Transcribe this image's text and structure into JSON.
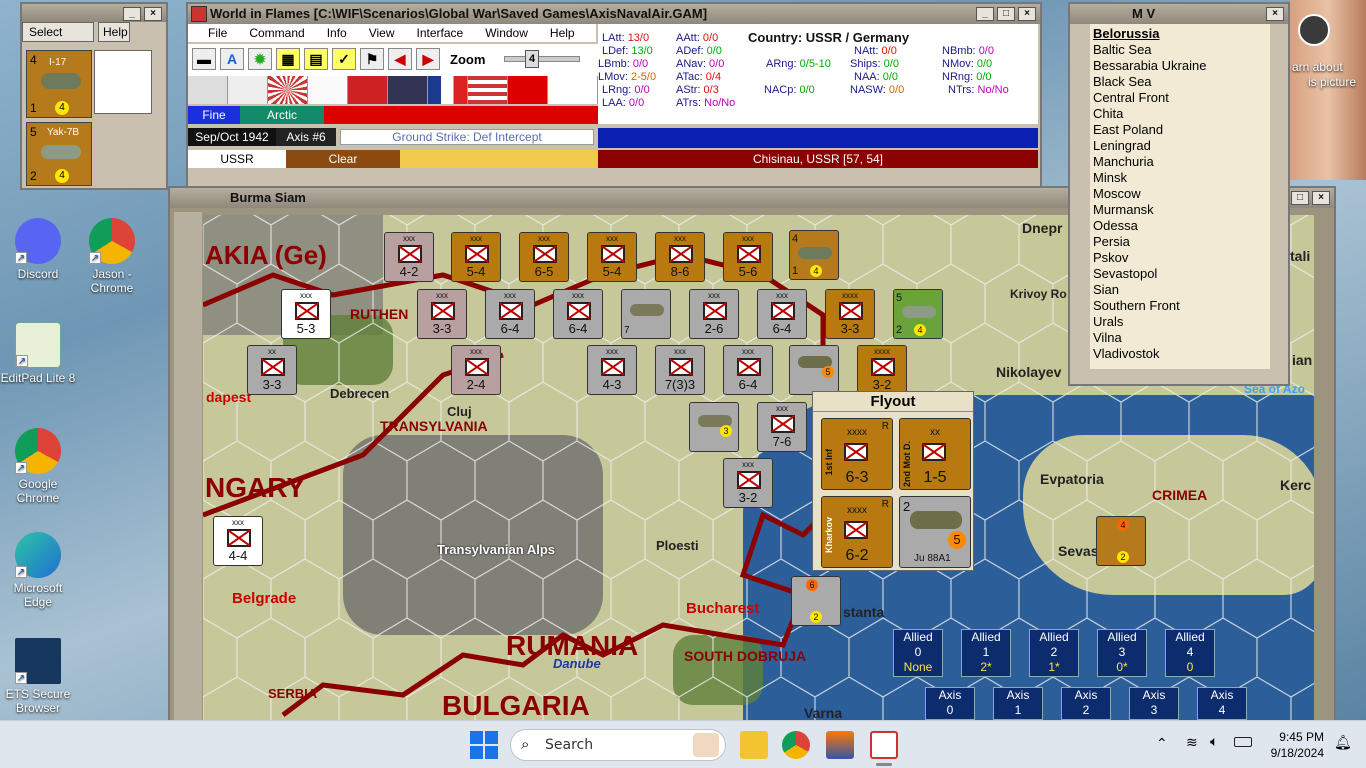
{
  "desktop_icons": [
    {
      "label": "Discord",
      "icon": "discord-icon"
    },
    {
      "label": "Jason -\nChrome",
      "icon": "chrome-profile-icon"
    },
    {
      "label": "EditPad Lite 8",
      "icon": "editpad-icon"
    },
    {
      "label": "Google\nChrome",
      "icon": "chrome-icon"
    },
    {
      "label": "Microsoft\nEdge",
      "icon": "edge-icon"
    },
    {
      "label": "ETS Secure\nBrowser",
      "icon": "ets-icon"
    }
  ],
  "desktop_peek": {
    "learn": "arn about",
    "picture": "is picture"
  },
  "select_window": {
    "tab_select": "Select",
    "tab_help": "Help",
    "units": [
      {
        "name": "I-17",
        "top": "4",
        "bottom": "1",
        "circle": "4"
      },
      {
        "name": "Yak-7B",
        "top": "5",
        "bottom": "2",
        "circle": "4"
      }
    ]
  },
  "main_window": {
    "title": "World in Flames [C:\\WIF\\Scenarios\\Global War\\Saved Games\\AxisNavalAir.GAM]",
    "menu": [
      "File",
      "Command",
      "Info",
      "View",
      "Interface",
      "Window",
      "Help"
    ],
    "zoom_label": "Zoom",
    "zoom_value": "4",
    "weather": "Fine",
    "zone": "Arctic",
    "date": "Sep/Oct 1942",
    "impulse": "Axis #6",
    "phase": "Ground Strike: Def Intercept",
    "hex_owner": "USSR",
    "terrain": "Clear",
    "location": "Chisinau, USSR [57, 54]",
    "country": "Country: USSR / Germany",
    "stats": [
      [
        "LAtt:",
        "13/0",
        "AAtt:",
        "0/0",
        "",
        "",
        "NAtt:",
        "0/0",
        "NBmb:",
        "0/0"
      ],
      [
        "LDef:",
        "13/0",
        "ADef:",
        "0/0",
        "",
        "",
        "Ships:",
        "0/0",
        "NMov:",
        "0/0"
      ],
      [
        "LBmb:",
        "0/0",
        "ANav:",
        "0/0",
        "ARng:",
        "0/5-10",
        "Ships:",
        "0/0",
        "NMov:",
        "0/0"
      ],
      [
        "LMov:",
        "2-5/0",
        "ATac:",
        "0/4",
        "",
        "",
        "NAA:",
        "0/0",
        "NRng:",
        "0/0"
      ],
      [
        "LRng:",
        "0/0",
        "AStr:",
        "0/3",
        "NACp:",
        "0/0",
        "NASW:",
        "0/0",
        "NTrs:",
        "No/No"
      ],
      [
        "LAA:",
        "0/0",
        "ATrs:",
        "No/No",
        "",
        "",
        "",
        "",
        "",
        ""
      ]
    ]
  },
  "map_window": {
    "title": "Burma Siam",
    "labels": [
      {
        "text": "AKIA (Ge)",
        "color": "#8b0000"
      },
      {
        "text": "RUTHEN",
        "color": "#8b0000"
      },
      {
        "text": "Debrecen",
        "color": "#222"
      },
      {
        "text": "Cluj",
        "color": "#222"
      },
      {
        "text": "TRANSYLVANIA",
        "color": "#8b0000"
      },
      {
        "text": "NGARY",
        "color": "#8b0000"
      },
      {
        "text": "Transylvanian Alps",
        "color": "#fff"
      },
      {
        "text": "Ploesti",
        "color": "#222"
      },
      {
        "text": "Bucharest",
        "color": "#c00"
      },
      {
        "text": "Belgrade",
        "color": "#c00"
      },
      {
        "text": "RUMANIA",
        "color": "#8b0000"
      },
      {
        "text": "Danube",
        "color": "#1a3aa0"
      },
      {
        "text": "SOUTH DOBRUJA",
        "color": "#8b0000"
      },
      {
        "text": "SERBIA",
        "color": "#8b0000"
      },
      {
        "text": "BULGARIA",
        "color": "#8b0000"
      },
      {
        "text": "Varna",
        "color": "#222"
      },
      {
        "text": "stanta",
        "color": "#222"
      },
      {
        "text": "dapest",
        "color": "#c00"
      },
      {
        "text": "Dnepr",
        "color": "#222"
      },
      {
        "text": "Krivoy Ro",
        "color": "#222"
      },
      {
        "text": "Nikolayev",
        "color": "#222"
      },
      {
        "text": "Evpatoria",
        "color": "#222"
      },
      {
        "text": "CRIMEA",
        "color": "#8b0000"
      },
      {
        "text": "Sevas",
        "color": "#222"
      },
      {
        "text": "Kerc",
        "color": "#222"
      },
      {
        "text": "Sea of Azo",
        "color": "#3aa0ff"
      },
      {
        "text": "ian",
        "color": "#222"
      },
      {
        "text": "tali",
        "color": "#222"
      }
    ],
    "counters": [
      {
        "v": "4-2",
        "c": "#b9a0a0",
        "s": "xxx"
      },
      {
        "v": "5-4",
        "c": "#b87a10",
        "s": "xxx"
      },
      {
        "v": "6-5",
        "c": "#b87a10",
        "s": "xxx"
      },
      {
        "v": "5-4",
        "c": "#b87a10",
        "s": "xxx"
      },
      {
        "v": "8-6",
        "c": "#b87a10",
        "s": "xxx"
      },
      {
        "v": "5-6",
        "c": "#b87a10",
        "s": "xxx"
      },
      {
        "v": "5-3",
        "c": "#fff",
        "s": "xxx"
      },
      {
        "v": "3-3",
        "c": "#b9a0a0",
        "s": "xxx"
      },
      {
        "v": "6-4",
        "c": "#aaa",
        "s": "xxx"
      },
      {
        "v": "6-4",
        "c": "#aaa",
        "s": "xxx"
      },
      {
        "v": "2-6",
        "c": "#aaa",
        "s": "xxx"
      },
      {
        "v": "6-4",
        "c": "#aaa",
        "s": "xxx"
      },
      {
        "v": "3-3",
        "c": "#b87a10",
        "s": "xxxx"
      },
      {
        "v": "3-3",
        "c": "#aaa",
        "s": "xx"
      },
      {
        "v": "2-4",
        "c": "#b9a0a0",
        "s": "xxx"
      },
      {
        "v": "4-3",
        "c": "#aaa",
        "s": "xxx"
      },
      {
        "v": "7(3)3",
        "c": "#aaa",
        "s": "xxx"
      },
      {
        "v": "6-4",
        "c": "#aaa",
        "s": "xxx"
      },
      {
        "v": "3-2",
        "c": "#b87a10",
        "s": "xxxx"
      },
      {
        "v": "7-6",
        "c": "#aaa",
        "s": "xxx"
      },
      {
        "v": "3-2",
        "c": "#aaa",
        "s": "xxx"
      },
      {
        "v": "4-4",
        "c": "#fff",
        "s": "xxx"
      }
    ],
    "flyout": {
      "title": "Flyout",
      "units": [
        {
          "name": "1st Inf",
          "v": "6-3",
          "s": "xxxx",
          "tag": "R"
        },
        {
          "name": "2nd Mot D.",
          "v": "1-5",
          "s": "xx",
          "tag": ""
        },
        {
          "name": "Kharkov",
          "v": "6-2",
          "s": "xxxx",
          "tag": "R"
        },
        {
          "name": "Ju 88A1",
          "v": "5",
          "s": "",
          "tag": "2"
        }
      ]
    },
    "allied_boxes": [
      {
        "t": "Allied",
        "n": "0",
        "s": "None"
      },
      {
        "t": "Allied",
        "n": "1",
        "s": "2*"
      },
      {
        "t": "Allied",
        "n": "2",
        "s": "1*"
      },
      {
        "t": "Allied",
        "n": "3",
        "s": "0*"
      },
      {
        "t": "Allied",
        "n": "4",
        "s": "0"
      }
    ],
    "axis_boxes": [
      {
        "t": "Axis",
        "n": "0"
      },
      {
        "t": "Axis",
        "n": "1"
      },
      {
        "t": "Axis",
        "n": "2"
      },
      {
        "t": "Axis",
        "n": "3"
      },
      {
        "t": "Axis",
        "n": "4"
      }
    ]
  },
  "mv_window": {
    "title": "M V",
    "items": [
      "Belorussia",
      "Baltic Sea",
      "Bessarabia Ukraine",
      "Black Sea",
      "Central Front",
      "Chita",
      "East Poland",
      "Leningrad",
      "Manchuria",
      "Minsk",
      "Moscow",
      "Murmansk",
      "Odessa",
      "Persia",
      "Pskov",
      "Sevastopol",
      "Sian",
      "Southern Front",
      "Urals",
      "Vilna",
      "Vladivostok"
    ]
  },
  "taskbar": {
    "search_placeholder": "Search",
    "time": "9:45 PM",
    "date": "9/18/2024"
  },
  "colors": {
    "accent_blue": "#0b1fb0",
    "dark_red": "#8b0000",
    "gold": "#f2c94c"
  }
}
